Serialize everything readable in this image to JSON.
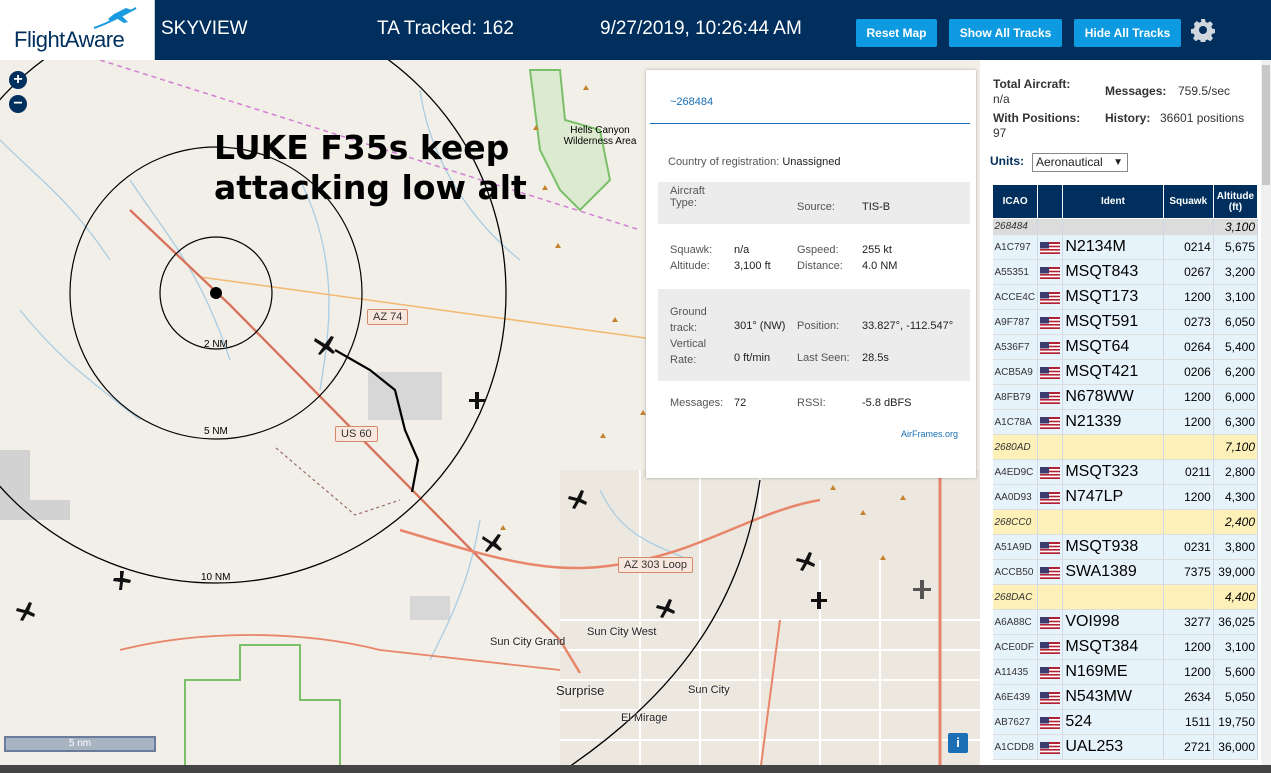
{
  "header": {
    "logo_text": "FlightAware",
    "site_name": "SKYVIEW",
    "ta_tracked": "TA Tracked: 162",
    "datetime": "9/27/2019, 10:26:44 AM",
    "buttons": {
      "reset": "Reset Map",
      "show": "Show All Tracks",
      "hide": "Hide All Tracks"
    },
    "settings_icon": "gear-icon"
  },
  "map": {
    "zoom_in": "+",
    "zoom_out": "−",
    "annotation": "LUKE F35s keep attacking low alt",
    "labels": {
      "wilderness": "Hells Canyon Wilderness Area",
      "az74": "AZ 74",
      "us60": "US 60",
      "az303": "AZ 303 Loop",
      "ring2": "2 NM",
      "ring5": "5 NM",
      "ring10": "10 NM",
      "sun_city_grand": "Sun City Grand",
      "sun_city_west": "Sun City West",
      "surprise": "Surprise",
      "sun_city": "Sun City",
      "el_mirage": "El Mirage"
    },
    "scale": "5 nm",
    "info": "i"
  },
  "popup": {
    "hex": "~268484",
    "country_label": "Country of registration:",
    "country_value": "Unassigned",
    "aircraft_type_label": "Aircraft Type:",
    "aircraft_type_value": "",
    "source_label": "Source:",
    "source_value": "TIS-B",
    "squawk_label": "Squawk:",
    "squawk_value": "n/a",
    "altitude_label": "Altitude:",
    "altitude_value": "3,100 ft",
    "gspeed_label": "Gspeed:",
    "gspeed_value": "255 kt",
    "distance_label": "Distance:",
    "distance_value": "4.0 NM",
    "track_label": "Ground track:",
    "track_value": "301° (NW)",
    "position_label": "Position:",
    "position_value": "33.827°, -112.547°",
    "vrate_label": "Vertical Rate:",
    "vrate_value": "0 ft/min",
    "lastseen_label": "Last Seen:",
    "lastseen_value": "28.5s",
    "messages_label": "Messages:",
    "messages_value": "72",
    "rssi_label": "RSSI:",
    "rssi_value": "-5.8 dBFS",
    "airframes": "AirFrames.org"
  },
  "sidebar": {
    "total_aircraft_label": "Total Aircraft:",
    "total_aircraft_value": "n/a",
    "messages_label": "Messages:",
    "messages_value": "759.5/sec",
    "with_positions_label": "With Positions:",
    "with_positions_value": "97",
    "history_label": "History:",
    "history_value": "36601 positions",
    "units_label": "Units:",
    "units_value": "Aeronautical",
    "columns": [
      "ICAO",
      "Ident",
      "Squawk",
      "Altitude (ft)"
    ],
    "rows": [
      {
        "icao": "268484",
        "ident": "",
        "squawk": "",
        "alt": "3,100",
        "kind": "sel"
      },
      {
        "icao": "A1C797",
        "ident": "N2134M",
        "squawk": "0214",
        "alt": "5,675",
        "kind": "row"
      },
      {
        "icao": "A55351",
        "ident": "MSQT843",
        "squawk": "0267",
        "alt": "3,200",
        "kind": "row"
      },
      {
        "icao": "ACCE4C",
        "ident": "MSQT173",
        "squawk": "1200",
        "alt": "3,100",
        "kind": "row"
      },
      {
        "icao": "A9F787",
        "ident": "MSQT591",
        "squawk": "0273",
        "alt": "6,050",
        "kind": "row"
      },
      {
        "icao": "A536F7",
        "ident": "MSQT64",
        "squawk": "0264",
        "alt": "5,400",
        "kind": "row"
      },
      {
        "icao": "ACB5A9",
        "ident": "MSQT421",
        "squawk": "0206",
        "alt": "6,200",
        "kind": "row"
      },
      {
        "icao": "A8FB79",
        "ident": "N678WW",
        "squawk": "1200",
        "alt": "6,000",
        "kind": "row"
      },
      {
        "icao": "A1C78A",
        "ident": "N21339",
        "squawk": "1200",
        "alt": "6,300",
        "kind": "row"
      },
      {
        "icao": "2680AD",
        "ident": "",
        "squawk": "",
        "alt": "7,100",
        "kind": "tisb"
      },
      {
        "icao": "A4ED9C",
        "ident": "MSQT323",
        "squawk": "0211",
        "alt": "2,800",
        "kind": "row"
      },
      {
        "icao": "AA0D93",
        "ident": "N747LP",
        "squawk": "1200",
        "alt": "4,300",
        "kind": "row"
      },
      {
        "icao": "268CC0",
        "ident": "",
        "squawk": "",
        "alt": "2,400",
        "kind": "tisb"
      },
      {
        "icao": "A51A9D",
        "ident": "MSQT938",
        "squawk": "0231",
        "alt": "3,800",
        "kind": "row"
      },
      {
        "icao": "ACCB50",
        "ident": "SWA1389",
        "squawk": "7375",
        "alt": "39,000",
        "kind": "row"
      },
      {
        "icao": "268DAC",
        "ident": "",
        "squawk": "",
        "alt": "4,400",
        "kind": "tisb"
      },
      {
        "icao": "A6A88C",
        "ident": "VOI998",
        "squawk": "3277",
        "alt": "36,025",
        "kind": "row"
      },
      {
        "icao": "ACE0DF",
        "ident": "MSQT384",
        "squawk": "1200",
        "alt": "3,100",
        "kind": "row"
      },
      {
        "icao": "A11435",
        "ident": "N169ME",
        "squawk": "1200",
        "alt": "5,600",
        "kind": "row"
      },
      {
        "icao": "A6E439",
        "ident": "N543MW",
        "squawk": "2634",
        "alt": "5,050",
        "kind": "row"
      },
      {
        "icao": "AB7627",
        "ident": "524",
        "squawk": "1511",
        "alt": "19,750",
        "kind": "row"
      },
      {
        "icao": "A1CDD8",
        "ident": "UAL253",
        "squawk": "2721",
        "alt": "36,000",
        "kind": "row"
      }
    ]
  }
}
